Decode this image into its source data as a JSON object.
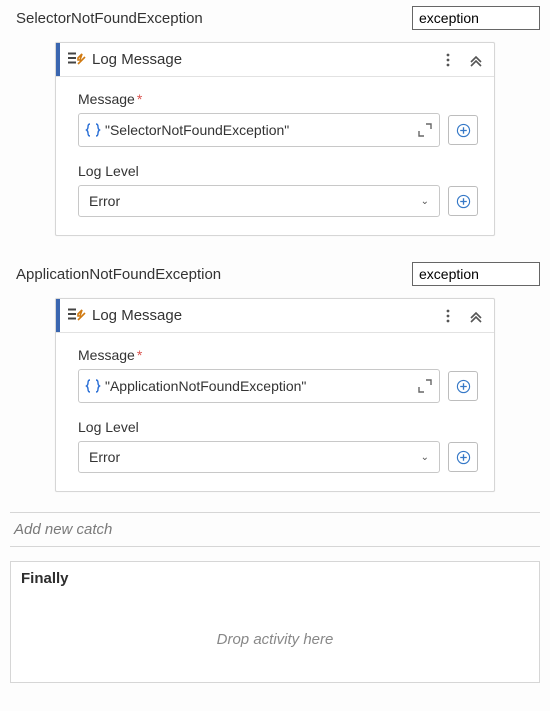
{
  "catches": [
    {
      "exception_name": "SelectorNotFoundException",
      "var_name": "exception",
      "activity": {
        "title": "Log Message",
        "message_label": "Message",
        "message_value": "\"SelectorNotFoundException\"",
        "loglevel_label": "Log Level",
        "loglevel_value": "Error"
      }
    },
    {
      "exception_name": "ApplicationNotFoundException",
      "var_name": "exception",
      "activity": {
        "title": "Log Message",
        "message_label": "Message",
        "message_value": "\"ApplicationNotFoundException\"",
        "loglevel_label": "Log Level",
        "loglevel_value": "Error"
      }
    }
  ],
  "add_catch_label": "Add new catch",
  "finally_title": "Finally",
  "finally_dropzone": "Drop activity here"
}
